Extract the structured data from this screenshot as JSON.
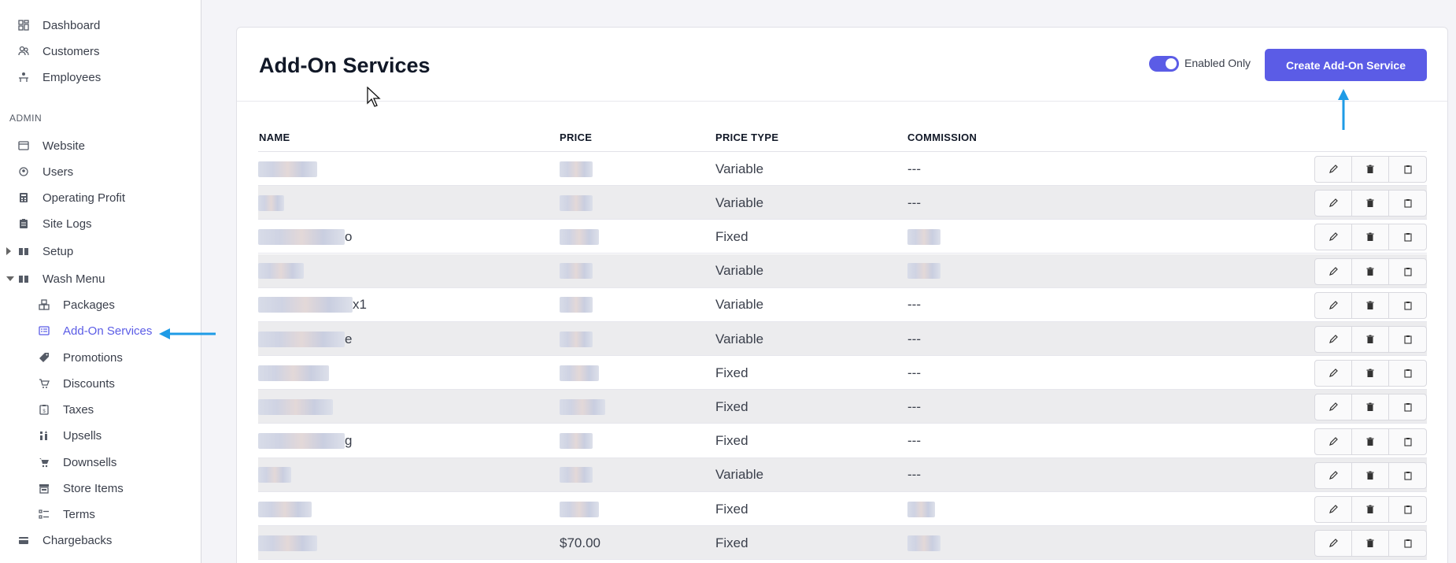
{
  "sidebar": {
    "top_items": [
      {
        "label": "Dashboard",
        "icon": "dashboard-icon"
      },
      {
        "label": "Customers",
        "icon": "customers-icon"
      },
      {
        "label": "Employees",
        "icon": "employees-icon"
      }
    ],
    "section_label": "ADMIN",
    "admin_items": [
      {
        "label": "Website",
        "icon": "website-icon"
      },
      {
        "label": "Users",
        "icon": "users-icon"
      },
      {
        "label": "Operating Profit",
        "icon": "calculator-icon"
      },
      {
        "label": "Site Logs",
        "icon": "clipboard-icon"
      },
      {
        "label": "Setup",
        "icon": "book-icon"
      },
      {
        "label": "Wash Menu",
        "icon": "book-icon"
      }
    ],
    "wash_menu_items": [
      {
        "label": "Packages",
        "icon": "packages-icon"
      },
      {
        "label": "Add-On Services",
        "icon": "list-icon",
        "active": true
      },
      {
        "label": "Promotions",
        "icon": "tag-icon"
      },
      {
        "label": "Discounts",
        "icon": "cart-discount-icon"
      },
      {
        "label": "Taxes",
        "icon": "receipt-icon"
      },
      {
        "label": "Upsells",
        "icon": "upsell-icon"
      },
      {
        "label": "Downsells",
        "icon": "cart-icon"
      },
      {
        "label": "Store Items",
        "icon": "store-icon"
      },
      {
        "label": "Terms",
        "icon": "terms-icon"
      }
    ],
    "bottom_items": [
      {
        "label": "Chargebacks",
        "icon": "credit-card-icon"
      }
    ]
  },
  "header": {
    "title": "Add-On Services",
    "toggle_label": "Enabled Only",
    "toggle_on": true,
    "create_button": "Create Add-On Service"
  },
  "table": {
    "columns": [
      "NAME",
      "PRICE",
      "PRICE TYPE",
      "COMMISSION"
    ],
    "rows": [
      {
        "name": "",
        "price": "",
        "price_type": "Variable",
        "commission": "---"
      },
      {
        "name": "",
        "price": "",
        "price_type": "Variable",
        "commission": "---"
      },
      {
        "name": "o",
        "price": "",
        "price_type": "Fixed",
        "commission": ""
      },
      {
        "name": "",
        "price": "",
        "price_type": "Variable",
        "commission": ""
      },
      {
        "name": "x1",
        "price": "",
        "price_type": "Variable",
        "commission": "---"
      },
      {
        "name": "e",
        "price": "",
        "price_type": "Variable",
        "commission": "---"
      },
      {
        "name": "",
        "price": "",
        "price_type": "Fixed",
        "commission": "---"
      },
      {
        "name": "",
        "price": "",
        "price_type": "Fixed",
        "commission": "---"
      },
      {
        "name": "g",
        "price": "",
        "price_type": "Fixed",
        "commission": "---"
      },
      {
        "name": "",
        "price": "",
        "price_type": "Variable",
        "commission": "---"
      },
      {
        "name": "",
        "price": "",
        "price_type": "Fixed",
        "commission": ""
      },
      {
        "name": "",
        "price": "$70.00",
        "price_type": "Fixed",
        "commission": ""
      }
    ]
  },
  "colors": {
    "accent": "#5b5ce6",
    "annotation_arrow": "#1e9be6"
  }
}
